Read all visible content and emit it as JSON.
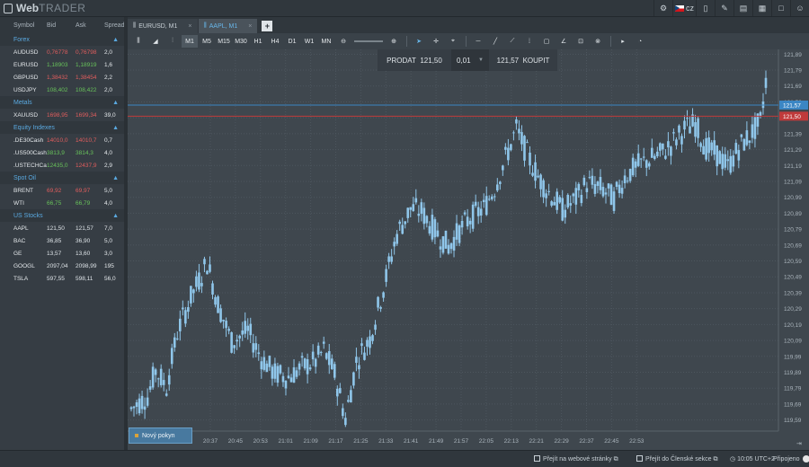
{
  "app": {
    "logo_bold": "Web",
    "logo_thin": "TRADER",
    "language": "cz"
  },
  "watchlist": {
    "headers": {
      "symbol": "Symbol",
      "bid": "Bid",
      "ask": "Ask",
      "spread": "Spread"
    },
    "groups": [
      {
        "name": "Forex",
        "rows": [
          {
            "symbol": "AUDUSD",
            "bid": "0,76778",
            "ask": "0,76798",
            "spread": "2,0",
            "color": "red"
          },
          {
            "symbol": "EURUSD",
            "bid": "1,18903",
            "ask": "1,18919",
            "spread": "1,6",
            "color": "green"
          },
          {
            "symbol": "GBPUSD",
            "bid": "1,38432",
            "ask": "1,38454",
            "spread": "2,2",
            "color": "red"
          },
          {
            "symbol": "USDJPY",
            "bid": "108,402",
            "ask": "108,422",
            "spread": "2,0",
            "color": "green"
          }
        ]
      },
      {
        "name": "Metals",
        "rows": [
          {
            "symbol": "XAUUSD",
            "bid": "1698,95",
            "ask": "1699,34",
            "spread": "39,0",
            "color": "red"
          }
        ]
      },
      {
        "name": "Equity Indexes",
        "rows": [
          {
            "symbol": ".DE30Cash",
            "bid": "14010,0",
            "ask": "14010,7",
            "spread": "0,7",
            "color": "red"
          },
          {
            "symbol": ".US500Cash",
            "bid": "3813,9",
            "ask": "3814,3",
            "spread": "4,0",
            "color": "green"
          },
          {
            "symbol": ".USTECHCa...",
            "bid": "12435,0",
            "ask": "12437,9",
            "spread": "2,9",
            "color": "green_red"
          }
        ]
      },
      {
        "name": "Spot Oil",
        "rows": [
          {
            "symbol": "BRENT",
            "bid": "69,92",
            "ask": "69,97",
            "spread": "5,0",
            "color": "red"
          },
          {
            "symbol": "WTI",
            "bid": "66,75",
            "ask": "66,79",
            "spread": "4,0",
            "color": "green"
          }
        ]
      },
      {
        "name": "US Stocks",
        "rows": [
          {
            "symbol": "AAPL",
            "bid": "121,50",
            "ask": "121,57",
            "spread": "7,0",
            "color": "white"
          },
          {
            "symbol": "BAC",
            "bid": "36,85",
            "ask": "36,90",
            "spread": "5,0",
            "color": "white"
          },
          {
            "symbol": "GE",
            "bid": "13,57",
            "ask": "13,60",
            "spread": "3,0",
            "color": "white"
          },
          {
            "symbol": "GOOGL",
            "bid": "2097,04",
            "ask": "2098,99",
            "spread": "195",
            "color": "white"
          },
          {
            "symbol": "TSLA",
            "bid": "597,55",
            "ask": "598,11",
            "spread": "56,0",
            "color": "white"
          }
        ]
      }
    ]
  },
  "tabs": [
    {
      "label": "EURUSD, M1",
      "active": false
    },
    {
      "label": "AAPL, M1",
      "active": true
    }
  ],
  "tab_close": "×",
  "tab_add": "+",
  "timeframes": [
    "M1",
    "M5",
    "M15",
    "M30",
    "H1",
    "H4",
    "D1",
    "W1",
    "MN"
  ],
  "active_timeframe": "M1",
  "order_bar": {
    "sell_label": "PRODAT",
    "sell_price": "121,50",
    "quantity": "0,01",
    "buy_price": "121,57",
    "buy_label": "KOUPIT"
  },
  "new_order_label": "Nový pokyn",
  "chart_data": {
    "type": "candlestick",
    "symbol": "AAPL",
    "timeframe": "M1",
    "ylim": [
      119.52,
      121.92
    ],
    "y_ticks": [
      "121,89",
      "121,79",
      "121,69",
      "121,59",
      "121,49",
      "121,39",
      "121,29",
      "121,19",
      "121,09",
      "120,99",
      "120,89",
      "120,79",
      "120,69",
      "120,59",
      "120,49",
      "120,39",
      "120,29",
      "120,19",
      "120,09",
      "119,99",
      "119,89",
      "119,79",
      "119,69",
      "119,59"
    ],
    "x_ticks": [
      "20:37",
      "20:45",
      "20:53",
      "21:01",
      "21:09",
      "21:17",
      "21:25",
      "21:33",
      "21:41",
      "21:49",
      "21:57",
      "22:05",
      "22:13",
      "22:21",
      "22:29",
      "22:37",
      "22:45",
      "22:53"
    ],
    "ask_line": {
      "value": 121.57,
      "label": "121,57",
      "color": "#3b86c4"
    },
    "bid_line": {
      "value": 121.5,
      "label": "121,50",
      "color": "#c03a3a"
    },
    "candle_color": "#8fc6ea",
    "anchors": [
      [
        0,
        119.66
      ],
      [
        6,
        119.74
      ],
      [
        9,
        119.9
      ],
      [
        13,
        119.8
      ],
      [
        17,
        120.14
      ],
      [
        22,
        120.36
      ],
      [
        28,
        120.58
      ],
      [
        32,
        120.32
      ],
      [
        37,
        120.08
      ],
      [
        43,
        120.15
      ],
      [
        48,
        119.98
      ],
      [
        53,
        119.88
      ],
      [
        58,
        119.86
      ],
      [
        63,
        119.92
      ],
      [
        68,
        119.96
      ],
      [
        71,
        120.03
      ],
      [
        75,
        119.88
      ],
      [
        79,
        119.6
      ],
      [
        83,
        119.96
      ],
      [
        88,
        120.1
      ],
      [
        93,
        120.42
      ],
      [
        98,
        120.76
      ],
      [
        103,
        120.92
      ],
      [
        107,
        120.9
      ],
      [
        112,
        120.78
      ],
      [
        117,
        120.68
      ],
      [
        121,
        120.78
      ],
      [
        125,
        120.86
      ],
      [
        130,
        120.92
      ],
      [
        134,
        121.05
      ],
      [
        139,
        121.28
      ],
      [
        142,
        121.42
      ],
      [
        146,
        121.26
      ],
      [
        150,
        121.12
      ],
      [
        154,
        121.02
      ],
      [
        159,
        120.91
      ],
      [
        164,
        120.98
      ],
      [
        168,
        121.08
      ],
      [
        173,
        121.05
      ],
      [
        178,
        120.98
      ],
      [
        182,
        121.12
      ],
      [
        186,
        121.18
      ],
      [
        190,
        121.22
      ],
      [
        195,
        121.26
      ],
      [
        199,
        121.32
      ],
      [
        204,
        121.42
      ],
      [
        208,
        121.45
      ],
      [
        212,
        121.3
      ],
      [
        216,
        121.26
      ],
      [
        220,
        121.18
      ],
      [
        224,
        121.3
      ],
      [
        228,
        121.38
      ],
      [
        232,
        121.46
      ],
      [
        234,
        121.72
      ]
    ]
  },
  "status_bar": {
    "website": "Přejít na webové stránky",
    "members": "Přejít do Členské sekce",
    "time": "10:05 UTC+2",
    "connection": "Připojeno"
  }
}
